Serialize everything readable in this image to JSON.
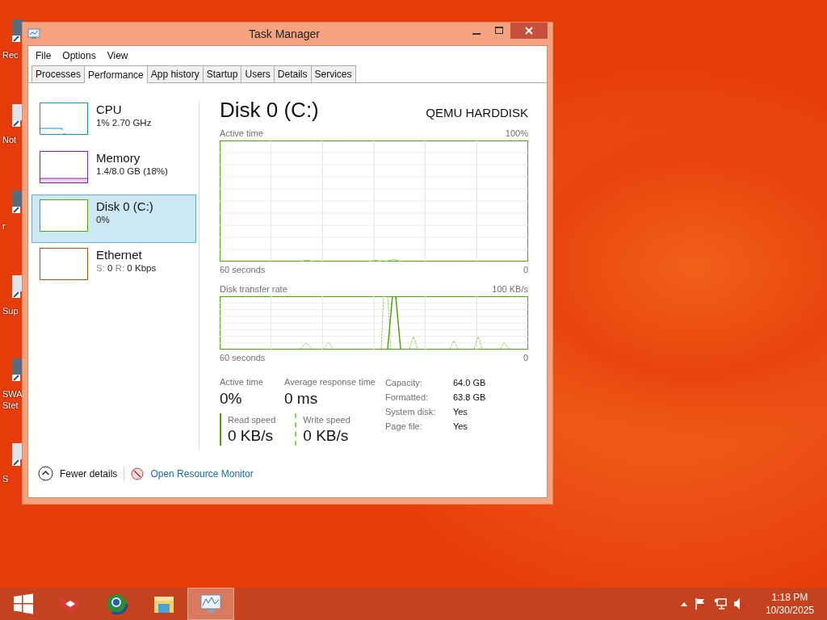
{
  "desktop_icons": [
    {
      "lines": [
        "Rec"
      ]
    },
    {
      "lines": [
        "Not"
      ]
    },
    {
      "lines": [
        "r"
      ]
    },
    {
      "lines": [
        "Sup"
      ]
    },
    {
      "lines": [
        "SWA",
        "Stet"
      ]
    },
    {
      "lines": [
        "S"
      ]
    }
  ],
  "window": {
    "title": "Task Manager"
  },
  "menu": [
    "File",
    "Options",
    "View"
  ],
  "tabs": [
    {
      "label": "Processes",
      "selected": false
    },
    {
      "label": "Performance",
      "selected": true
    },
    {
      "label": "App history",
      "selected": false
    },
    {
      "label": "Startup",
      "selected": false
    },
    {
      "label": "Users",
      "selected": false
    },
    {
      "label": "Details",
      "selected": false
    },
    {
      "label": "Services",
      "selected": false
    }
  ],
  "sidebar": {
    "items": [
      {
        "name": "CPU",
        "detail": "1% 2.70 GHz",
        "color": "#1b8ec2",
        "selected": false
      },
      {
        "name": "Memory",
        "detail": "1.4/8.0 GB (18%)",
        "color": "#8b21a8",
        "selected": false
      },
      {
        "name": "Disk 0 (C:)",
        "detail": "0%",
        "color": "#4ea40f",
        "selected": true
      },
      {
        "name": "Ethernet",
        "detail_parts": [
          {
            "label": "S:",
            "value": "0"
          },
          {
            "label": "R:",
            "value": "0 Kbps"
          }
        ],
        "color": "#a7530a",
        "selected": false
      }
    ]
  },
  "detail": {
    "title": "Disk 0 (C:)",
    "model": "QEMU HARDDISK",
    "graphs": [
      {
        "label": "Active time",
        "max": "100%",
        "time": "60 seconds",
        "min": "0"
      },
      {
        "label": "Disk transfer rate",
        "max": "100 KB/s",
        "time": "60 seconds",
        "min": "0"
      }
    ],
    "stats": [
      {
        "label": "Active time",
        "value": "0%"
      },
      {
        "label": "Average response time",
        "value": "0 ms"
      }
    ],
    "speeds": [
      {
        "label": "Read speed",
        "value": "0 KB/s",
        "kind": "solid"
      },
      {
        "label": "Write speed",
        "value": "0 KB/s",
        "kind": "dashed"
      }
    ],
    "properties": [
      {
        "label": "Capacity:",
        "value": "64.0 GB"
      },
      {
        "label": "Formatted:",
        "value": "63.8 GB"
      },
      {
        "label": "System disk:",
        "value": "Yes"
      },
      {
        "label": "Page file:",
        "value": "Yes"
      }
    ]
  },
  "footer": {
    "toggle": "Fewer details",
    "link": "Open Resource Monitor"
  },
  "taskbar": {
    "apps": [
      {
        "selected": false
      },
      {
        "selected": false
      },
      {
        "selected": false
      },
      {
        "selected": true
      }
    ],
    "time": "1:18 PM",
    "date": "10/30/2025"
  }
}
